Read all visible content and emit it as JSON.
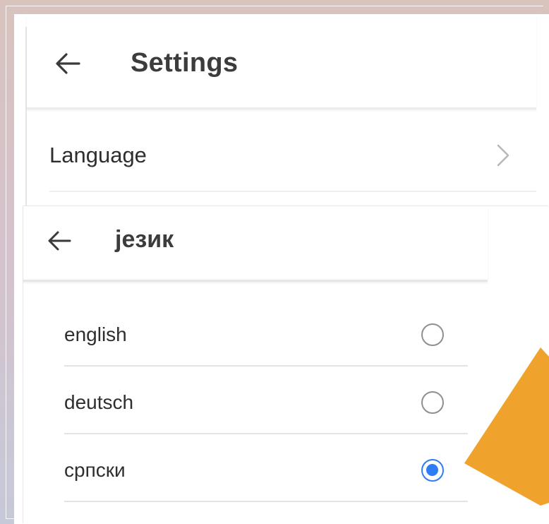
{
  "settings_screen": {
    "title": "Settings",
    "back_icon": "arrow-left-icon",
    "items": [
      {
        "label": "Language",
        "icon": "chevron-right-icon"
      }
    ]
  },
  "language_screen": {
    "title": "језик",
    "back_icon": "arrow-left-icon",
    "options": [
      {
        "label": "english",
        "selected": false
      },
      {
        "label": "deutsch",
        "selected": false
      },
      {
        "label": "српски",
        "selected": true
      }
    ],
    "selected_value": "српски"
  },
  "colors": {
    "accent": "#2e7cf6",
    "pointer": "#efa32c",
    "text": "#2e2e2e",
    "radio_unselected": "#8f8f8f"
  },
  "annotation": {
    "type": "pointer-triangle",
    "points_to": "српски"
  }
}
